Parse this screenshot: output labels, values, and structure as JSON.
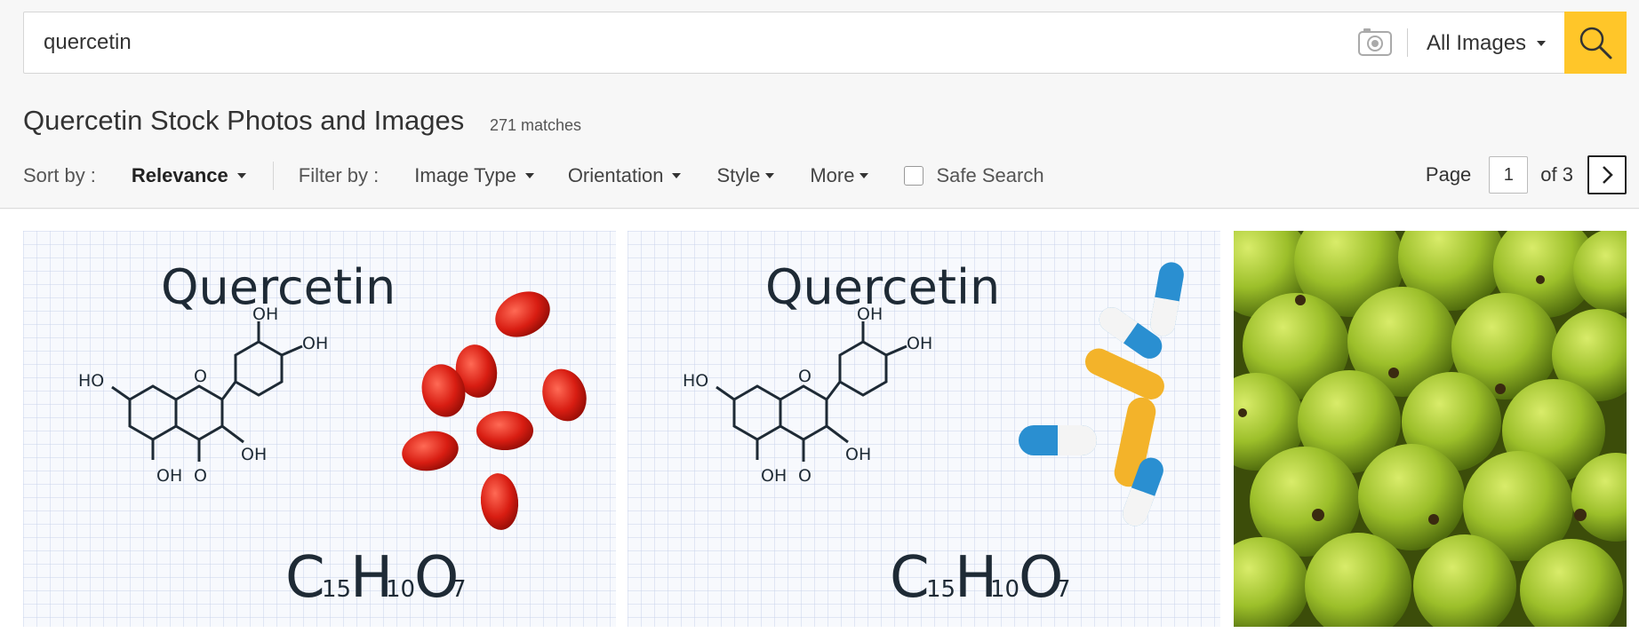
{
  "search": {
    "query": "quercetin",
    "scope": "All Images"
  },
  "results_header": {
    "title": "Quercetin Stock Photos and Images",
    "matches": "271 matches"
  },
  "filters": {
    "sort_label": "Sort by :",
    "sort_value": "Relevance",
    "filter_label": "Filter by :",
    "image_type": "Image Type",
    "orientation": "Orientation",
    "style": "Style",
    "more": "More",
    "safe_search": "Safe Search"
  },
  "pager": {
    "page_label": "Page",
    "current": "1",
    "total": "of 3"
  },
  "images": [
    {
      "title": "Quercetin",
      "formula": [
        "C",
        "15",
        "H",
        "10",
        "O",
        "7"
      ],
      "groups": [
        "OH",
        "OH",
        "HO",
        "OH",
        "OH",
        "O",
        "O"
      ]
    },
    {
      "title": "Quercetin",
      "formula": [
        "C",
        "15",
        "H",
        "10",
        "O",
        "7"
      ],
      "groups": [
        "OH",
        "OH",
        "HO",
        "OH",
        "OH",
        "O",
        "O"
      ]
    }
  ],
  "colors": {
    "accent": "#ffc629",
    "capsule_red": "#d81d12",
    "pill_blue": "#2a8fd1",
    "pill_yellow": "#f3b32a",
    "guava_green": "#9cbf2a"
  }
}
